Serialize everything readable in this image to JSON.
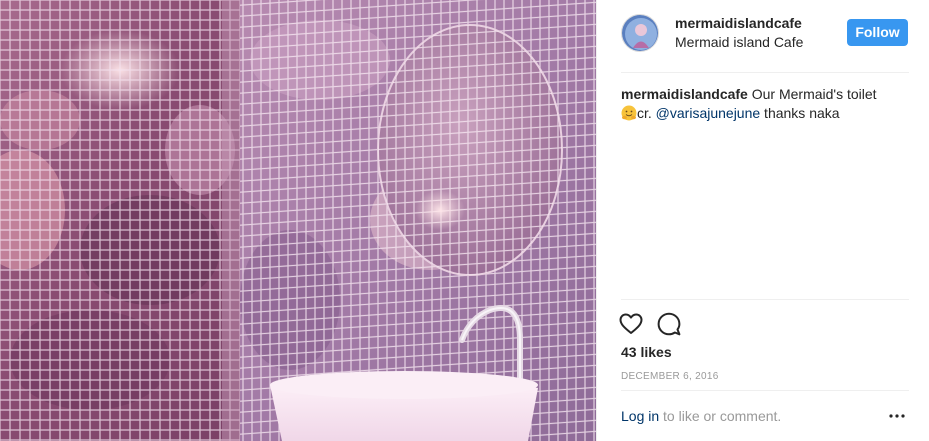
{
  "post": {
    "username": "mermaidislandcafe",
    "location": "Mermaid island Cafe",
    "follow_label": "Follow",
    "caption": {
      "username": "mermaidislandcafe",
      "text_before": " Our Mermaid's toilet",
      "credit_prefix": "cr. ",
      "mention": "@varisajunejune",
      "text_after": " thanks naka"
    },
    "likes": "43 likes",
    "date": "DECEMBER 6, 2016",
    "login_link": "Log in",
    "login_suffix": " to like or comment.",
    "more_label": "•••"
  },
  "icons": {
    "like": "heart-icon",
    "comment": "comment-icon",
    "emoji": "hugging-face-emoji",
    "more": "more-options-icon"
  },
  "colors": {
    "follow_button": "#3897f0",
    "link": "#003569",
    "secondary_text": "#999999",
    "divider": "#efefef"
  }
}
